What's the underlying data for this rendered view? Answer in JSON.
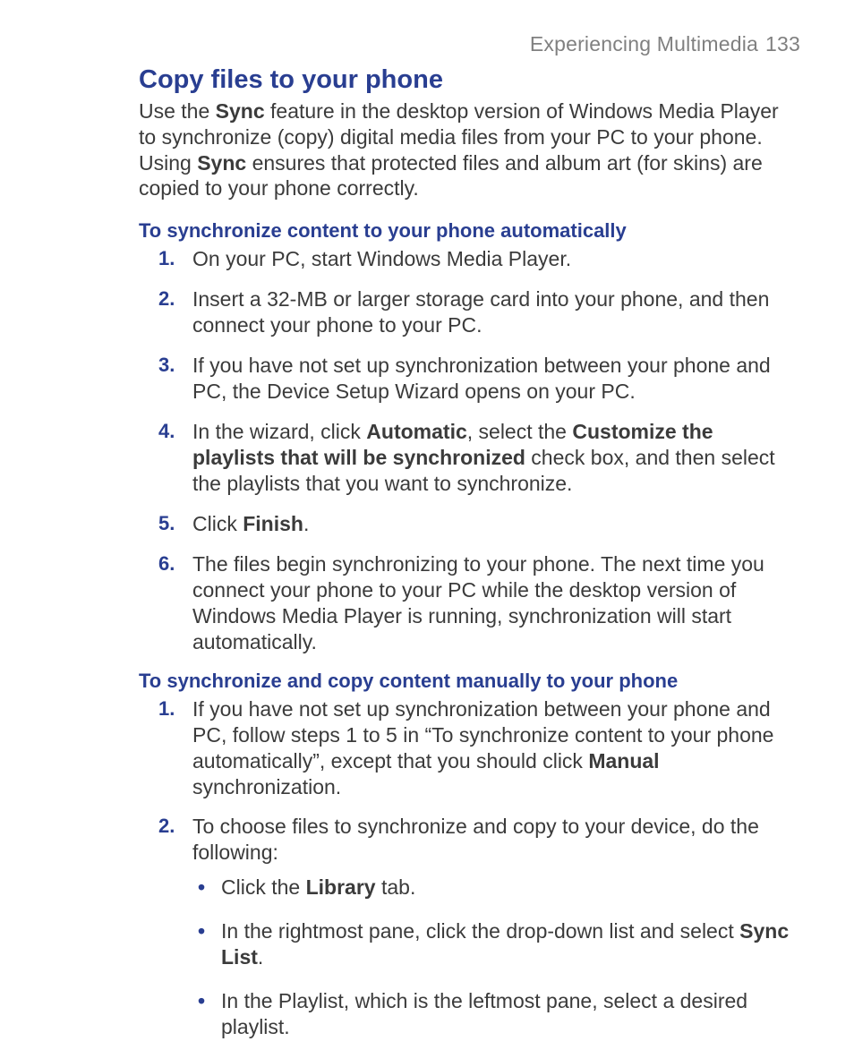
{
  "header": {
    "section": "Experiencing Multimedia",
    "page": "133"
  },
  "title": "Copy files to your phone",
  "intro": {
    "p1a": "Use the ",
    "p1_sync": "Sync",
    "p1b": " feature in the desktop version of Windows Media Player to synchronize (copy) digital media files from your PC to your phone. Using ",
    "p1c": " ensures that protected files and album art (for skins) are copied to your phone correctly."
  },
  "sectionA": {
    "heading": "To synchronize content to your phone automatically",
    "s1": "On your PC, start Windows Media Player.",
    "s2": "Insert a 32-MB or larger storage card into your phone, and then connect your phone to your PC.",
    "s3": "If you have not set up synchronization between your phone and PC, the Device Setup Wizard opens on your PC.",
    "s4a": "In the wizard, click ",
    "s4_auto": "Automatic",
    "s4b": ", select the ",
    "s4_cust": "Customize the playlists that will be synchronized",
    "s4c": " check box, and then select the playlists that you want to synchronize.",
    "s5a": "Click ",
    "s5_finish": "Finish",
    "s5b": ".",
    "s6": "The files begin synchronizing to your phone. The next time you connect your phone to your PC while the desktop version of Windows Media Player is running, synchronization will start automatically."
  },
  "sectionB": {
    "heading": "To synchronize and copy content manually to your phone",
    "s1a": "If you have not set up synchronization between your phone and PC, follow steps 1 to 5 in “To synchronize content to your phone automatically”, except that you should click ",
    "s1_manual": "Manual",
    "s1b": " synchronization.",
    "s2": "To choose files to synchronize and copy to your device, do the following:",
    "b1a": "Click the ",
    "b1_lib": "Library",
    "b1b": " tab.",
    "b2a": "In the rightmost pane, click the drop-down list and select ",
    "b2_sync": "Sync List",
    "b2b": ".",
    "b3": "In the Playlist, which is the leftmost pane, select a desired playlist."
  }
}
